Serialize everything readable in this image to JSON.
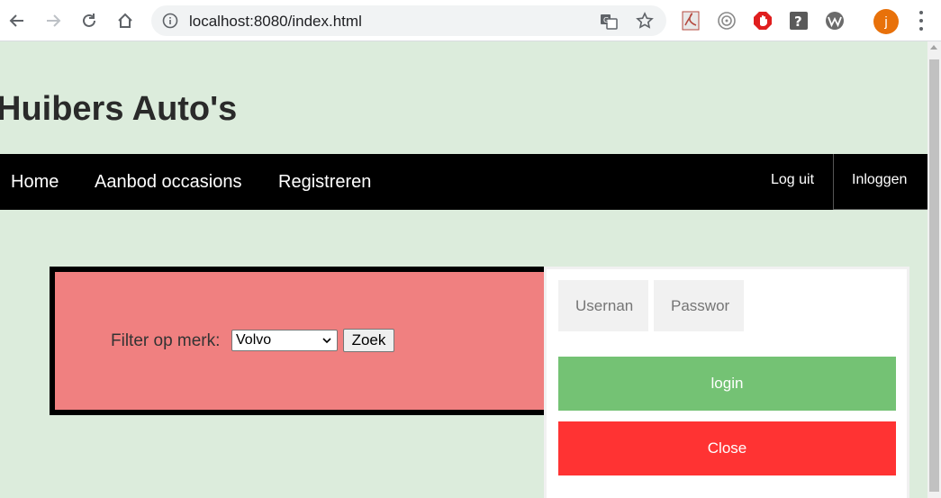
{
  "browser": {
    "url": "localhost:8080/index.html",
    "avatar_letter": "j",
    "extensions": [
      "pdf-icon",
      "audio-icon",
      "adblock-icon",
      "help-icon",
      "wordpress-icon"
    ]
  },
  "site": {
    "title": "Huibers Auto's"
  },
  "nav": {
    "items": [
      "Home",
      "Aanbod occasions",
      "Registreren"
    ],
    "logout": "Log uit",
    "login": "Inloggen"
  },
  "filter": {
    "label": "Filter op merk:",
    "selected": "Volvo",
    "button": "Zoek"
  },
  "login_form": {
    "username_placeholder": "Usernan",
    "password_placeholder": "Passwor",
    "login_button": "login",
    "close_button": "Close"
  },
  "colors": {
    "page_bg": "#dcecdc",
    "filter_bg": "#f08080",
    "login_green": "#74c274",
    "close_red": "#ff3333"
  }
}
